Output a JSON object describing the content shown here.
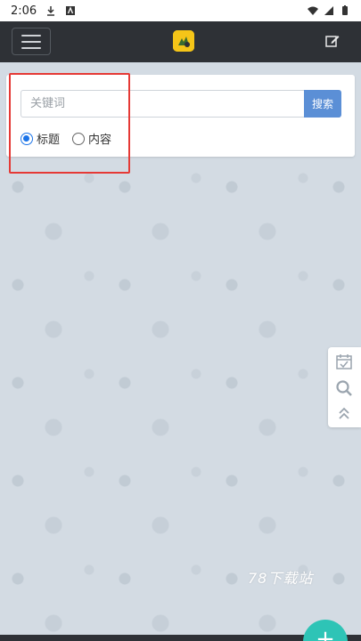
{
  "status_bar": {
    "time": "2:06"
  },
  "navbar": {
    "menu_icon": "hamburger-icon",
    "logo_icon": "app-logo-icon",
    "edit_icon": "edit-icon"
  },
  "search": {
    "placeholder": "关键词",
    "value": "",
    "button_label": "搜索",
    "options": [
      {
        "label": "标题",
        "checked": true
      },
      {
        "label": "内容",
        "checked": false
      }
    ]
  },
  "side_tools": [
    "calendar-check-icon",
    "search-icon",
    "double-chevron-up-icon"
  ],
  "watermark": "78下载站",
  "colors": {
    "navbar": "#2e3136",
    "accent": "#5b8fd6",
    "highlight": "#e53935",
    "fab": "#2ec4b6"
  }
}
